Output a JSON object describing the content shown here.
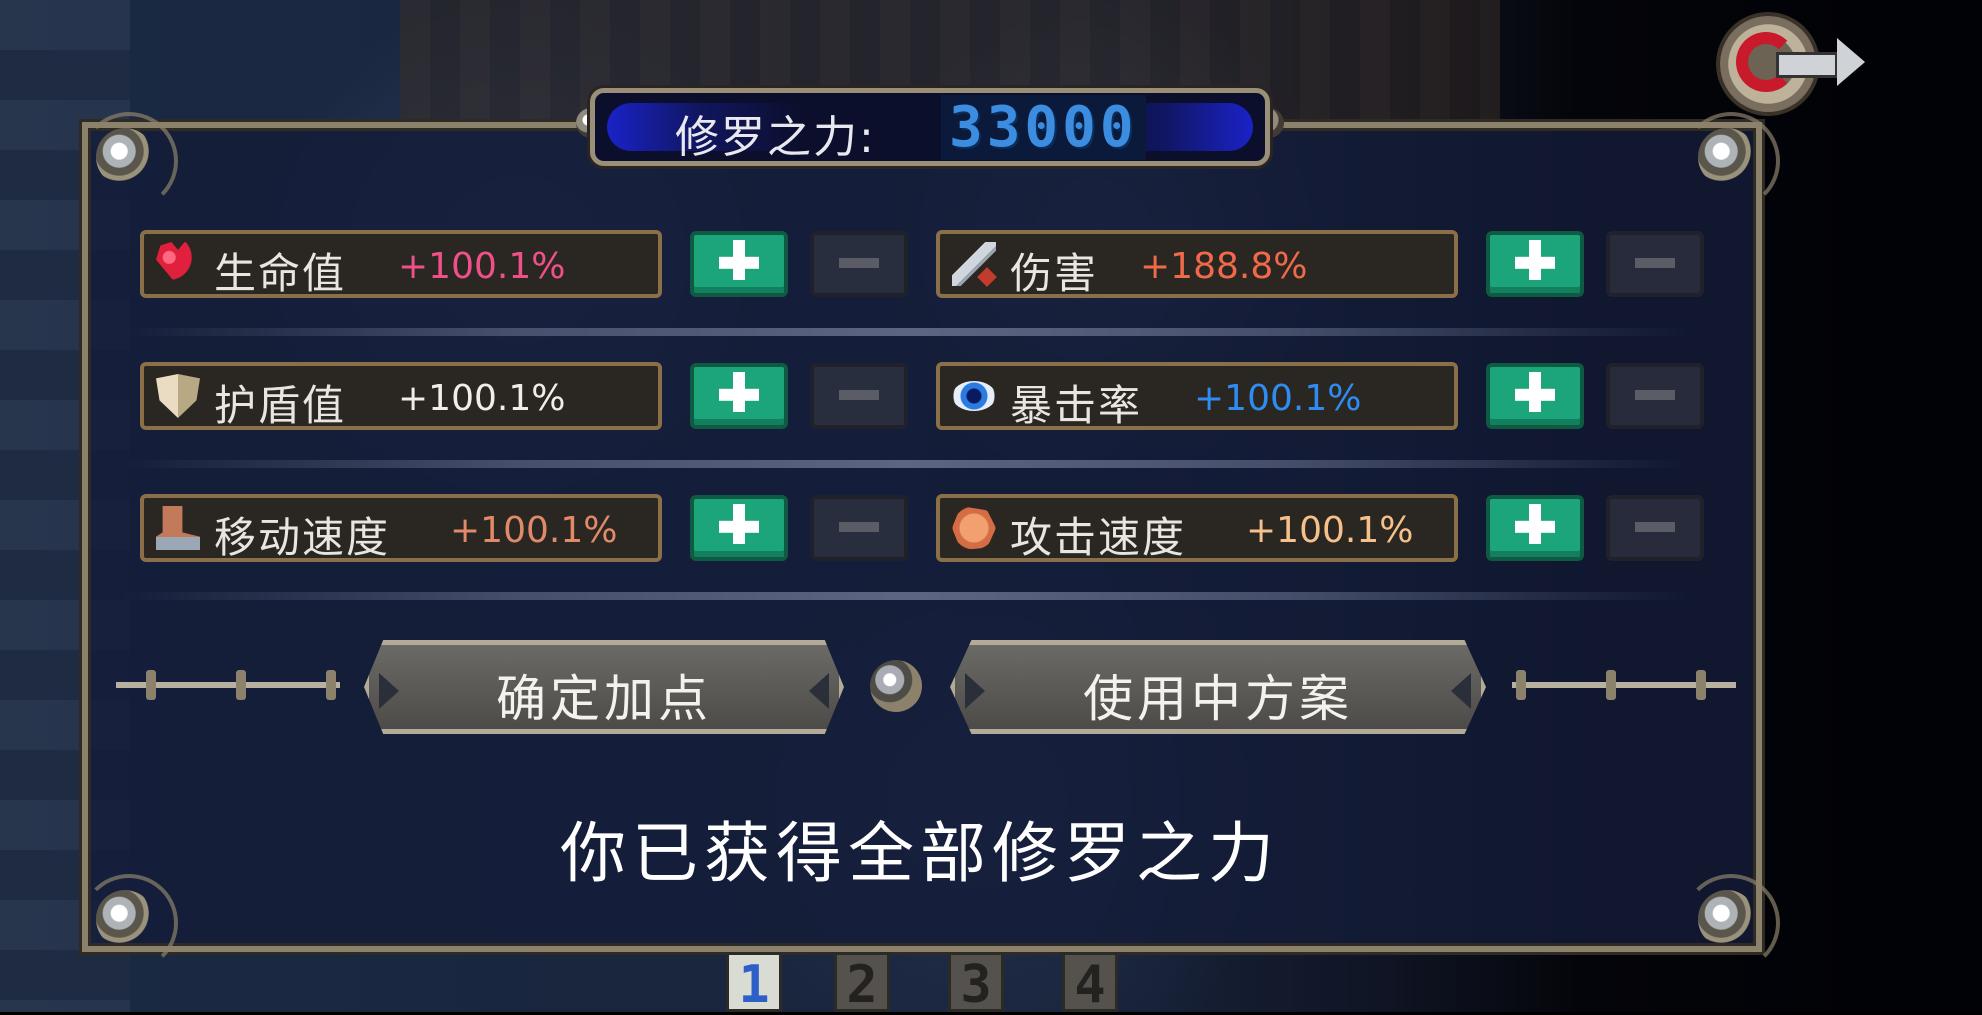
{
  "power": {
    "label": "修罗之力:",
    "value": "33000"
  },
  "stats": [
    {
      "name": "生命值",
      "value": "+100.1%",
      "color": "#f0508a",
      "icon": "heart-icon"
    },
    {
      "name": "伤害",
      "value": "+188.8%",
      "color": "#f06a4a",
      "icon": "sword-icon"
    },
    {
      "name": "护盾值",
      "value": "+100.1%",
      "color": "#f2eee6",
      "icon": "shield-icon"
    },
    {
      "name": "暴击率",
      "value": "+100.1%",
      "color": "#2f8cf0",
      "icon": "eye-icon"
    },
    {
      "name": "移动速度",
      "value": "+100.1%",
      "color": "#e08a6a",
      "icon": "boot-icon"
    },
    {
      "name": "攻击速度",
      "value": "+100.1%",
      "color": "#f5c08a",
      "icon": "fist-icon"
    }
  ],
  "actions": {
    "confirm": "确定加点",
    "in_use": "使用中方案"
  },
  "message": "你已获得全部修罗之力",
  "tabs": [
    "1",
    "2",
    "3",
    "4"
  ],
  "active_tab": "1"
}
